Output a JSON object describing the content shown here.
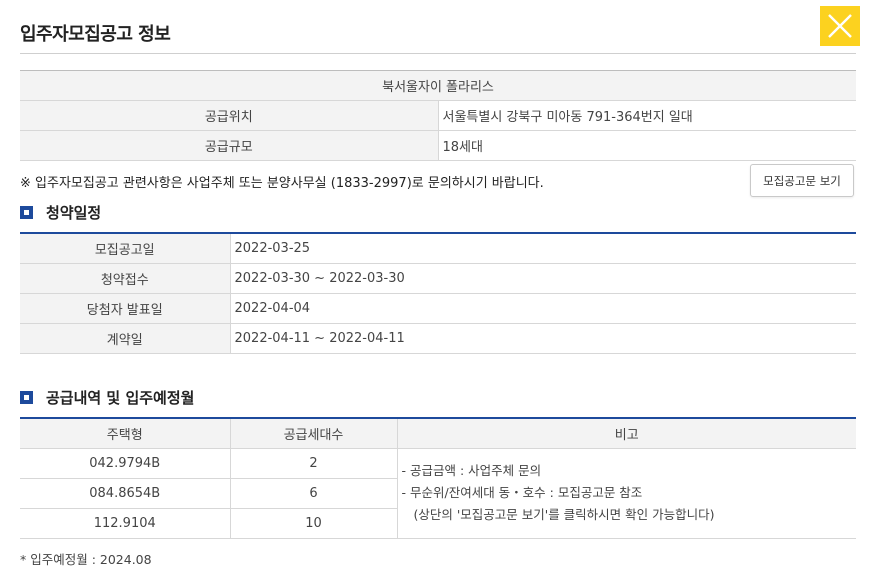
{
  "header": {
    "title": "입주자모집공고 정보",
    "close_icon": "close-icon"
  },
  "supply_info": {
    "complex_name": "북서울자이 폴라리스",
    "rows": [
      {
        "label": "공급위치",
        "value": "서울특별시 강북구 미아동 791-364번지 일대"
      },
      {
        "label": "공급규모",
        "value": "18세대"
      }
    ]
  },
  "notice": "※ 입주자모집공고 관련사항은 사업주체 또는 분양사무실 (1833-2997)로 문의하시기 바랍니다.",
  "doc_button_label": "모집공고문 보기",
  "schedule": {
    "title": "청약일정",
    "rows": [
      {
        "label": "모집공고일",
        "value": "2022-03-25"
      },
      {
        "label": "청약접수",
        "value": "2022-03-30 ~ 2022-03-30"
      },
      {
        "label": "당첨자 발표일",
        "value": "2022-04-04"
      },
      {
        "label": "계약일",
        "value": "2022-04-11 ~ 2022-04-11"
      }
    ]
  },
  "supply_detail": {
    "title": "공급내역 및 입주예정월",
    "headers": [
      "주택형",
      "공급세대수",
      "비고"
    ],
    "rows": [
      {
        "type": "042.9794B",
        "units": "2"
      },
      {
        "type": "084.8654B",
        "units": "6"
      },
      {
        "type": "112.9104",
        "units": "10"
      }
    ],
    "notes": [
      "-  공급금액 : 사업주체 문의",
      "-  무순위/잔여세대 동・호수 : 모집공고문 참조",
      "(상단의 '모집공고문 보기'를 클릭하시면 확인 가능합니다)"
    ]
  },
  "footnote": "* 입주예정월 : 2024.08",
  "colors": {
    "accent": "#1d4a9c",
    "close_bg": "#fcd21f"
  }
}
